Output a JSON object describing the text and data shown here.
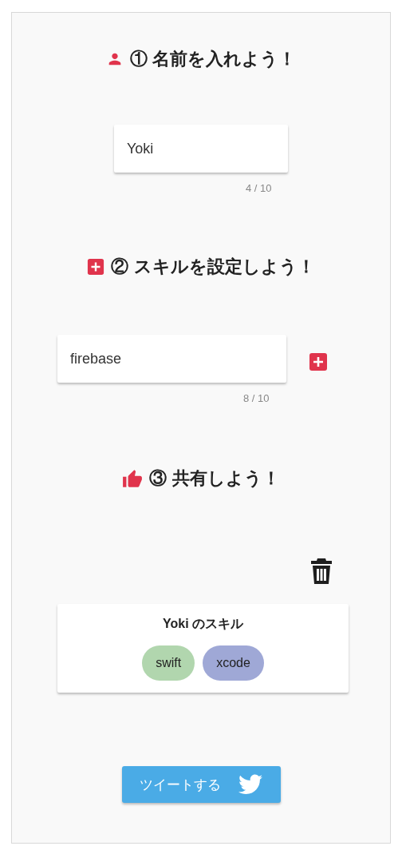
{
  "name_step": {
    "title": "① 名前を入れよう！",
    "field": {
      "value": "Yoki",
      "counter": "4 / 10"
    }
  },
  "skill_step": {
    "title": "② スキルを設定しよう！",
    "field": {
      "value": "firebase",
      "counter": "8 / 10"
    }
  },
  "share_step": {
    "title": "③ 共有しよう！",
    "card": {
      "title": "Yoki のスキル",
      "skills": [
        {
          "label": "swift",
          "color": "#b1d6ae"
        },
        {
          "label": "xcode",
          "color": "#9fa8d6"
        }
      ]
    }
  },
  "tweet_button": {
    "label": "ツイートする"
  }
}
